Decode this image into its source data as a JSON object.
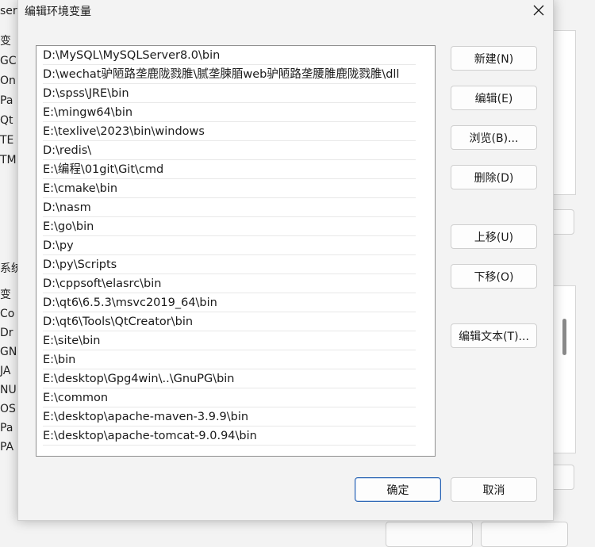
{
  "background": {
    "title_fragment": "ser",
    "user_vars_header": "变",
    "user_vars": [
      "GC",
      "On",
      "Pa",
      "Qt",
      "TE",
      "TM"
    ],
    "system_label": "系统",
    "system_vars_header": "变",
    "system_vars": [
      "Co",
      "Dr",
      "GN",
      "JA",
      "NU",
      "OS",
      "Pa",
      "PA"
    ]
  },
  "dialog": {
    "title": "编辑环境变量",
    "close_icon": "close-icon",
    "entries": [
      "D:\\MySQL\\MySQLServer8.0\\bin",
      "D:\\wechat驴陋路垄鹿陇戮脽\\腻垄脨脜web驴陋路垄腰脽鹿陇戮脽\\dll",
      "D:\\spss\\JRE\\bin",
      "E:\\mingw64\\bin",
      "E:\\texlive\\2023\\bin\\windows",
      "D:\\redis\\",
      "E:\\编程\\01git\\Git\\cmd",
      "E:\\cmake\\bin",
      "D:\\nasm",
      "E:\\go\\bin",
      "D:\\py",
      "D:\\py\\Scripts",
      "D:\\cppsoft\\elasrc\\bin",
      "D:\\qt6\\6.5.3\\msvc2019_64\\bin",
      "D:\\qt6\\Tools\\QtCreator\\bin",
      "E:\\site\\bin",
      "E:\\bin",
      "E:\\desktop\\Gpg4win\\..\\GnuPG\\bin",
      "E:\\common",
      "E:\\desktop\\apache-maven-3.9.9\\bin",
      "E:\\desktop\\apache-tomcat-9.0.94\\bin"
    ],
    "buttons": {
      "new": "新建(N)",
      "edit": "编辑(E)",
      "browse": "浏览(B)...",
      "delete": "删除(D)",
      "move_up": "上移(U)",
      "move_down": "下移(O)",
      "edit_text": "编辑文本(T)...",
      "ok": "确定",
      "cancel": "取消"
    }
  }
}
